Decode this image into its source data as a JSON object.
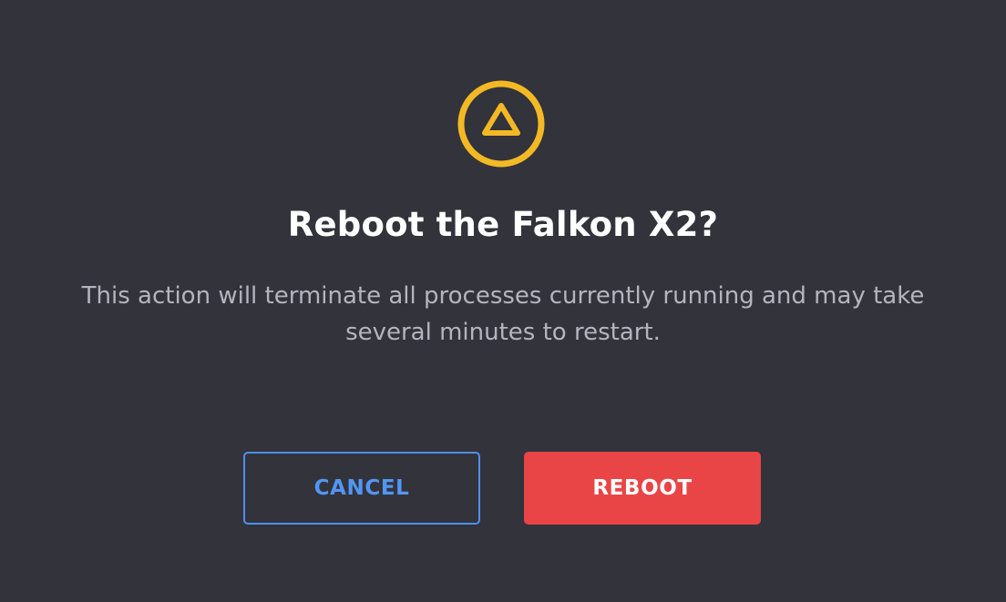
{
  "dialog": {
    "icon": "warning-triangle-icon",
    "title": "Reboot the Falkon X2?",
    "message": "This action will terminate all processes currently running and may take several minutes to restart.",
    "cancel_label": "CANCEL",
    "confirm_label": "REBOOT"
  },
  "colors": {
    "background": "#32333b",
    "warning": "#f3b925",
    "title": "#ffffff",
    "message": "#b4b5bf",
    "cancel": "#5296f5",
    "confirm": "#e94546"
  }
}
